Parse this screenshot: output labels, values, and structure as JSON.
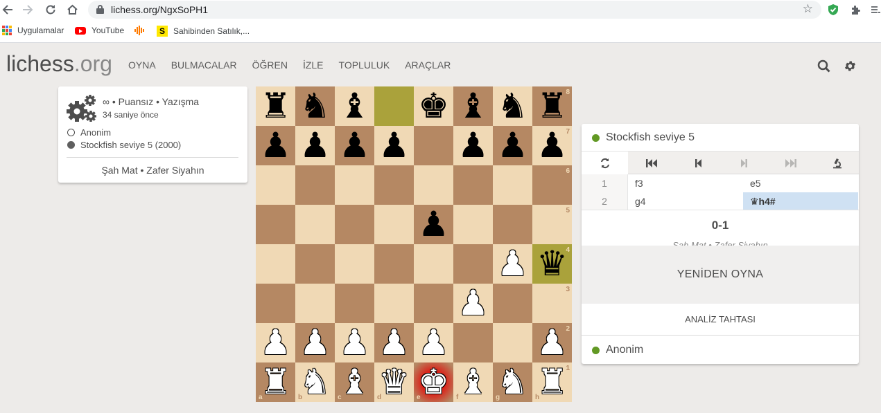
{
  "browser": {
    "url": "lichess.org/NgxSoPH1",
    "bookmarks": [
      {
        "label": "Uygulamalar",
        "icon": "apps-grid-icon"
      },
      {
        "label": "YouTube",
        "icon": "youtube-icon"
      },
      {
        "label": "",
        "icon": "soundwave-icon"
      },
      {
        "label": "Sahibinden Satılık,...",
        "icon": "sahibinden-icon"
      }
    ]
  },
  "header": {
    "logo_main": "lichess",
    "logo_tld": ".org",
    "nav": [
      "OYNA",
      "BULMACALAR",
      "ÖĞREN",
      "İZLE",
      "TOPLULUK",
      "ARAÇLAR"
    ]
  },
  "game_meta": {
    "line1": "∞ • Puansız • Yazışma",
    "line2": "34 saniye önce",
    "white_player": "Anonim",
    "black_player": "Stockfish seviye 5 (2000)",
    "status": "Şah Mat • Zafer Siyahın"
  },
  "board": {
    "ranks": [
      "8",
      "7",
      "6",
      "5",
      "4",
      "3",
      "2",
      "1"
    ],
    "files": [
      "a",
      "b",
      "c",
      "d",
      "e",
      "f",
      "g",
      "h"
    ],
    "position": [
      [
        "bR",
        "bN",
        "bB",
        "",
        "bK",
        "bB",
        "bN",
        "bR"
      ],
      [
        "bP",
        "bP",
        "bP",
        "bP",
        "",
        "bP",
        "bP",
        "bP"
      ],
      [
        "",
        "",
        "",
        "",
        "",
        "",
        "",
        ""
      ],
      [
        "",
        "",
        "",
        "",
        "bP",
        "",
        "",
        ""
      ],
      [
        "",
        "",
        "",
        "",
        "",
        "",
        "wP",
        "bQ"
      ],
      [
        "",
        "",
        "",
        "",
        "",
        "wP",
        "",
        ""
      ],
      [
        "wP",
        "wP",
        "wP",
        "wP",
        "wP",
        "",
        "",
        "wP"
      ],
      [
        "wR",
        "wN",
        "wB",
        "wQ",
        "wK",
        "wB",
        "wN",
        "wR"
      ]
    ],
    "last_move": [
      "d8",
      "h4"
    ],
    "check_square": "e1"
  },
  "panel": {
    "top_player": "Stockfish seviye 5",
    "bottom_player": "Anonim",
    "moves": [
      {
        "num": "1",
        "white": "f3",
        "black": "e5"
      },
      {
        "num": "2",
        "white": "g4",
        "black": "♛h4#"
      }
    ],
    "result": "0-1",
    "result_sub": "Şah Mat • Zafer Siyahın",
    "replay_label": "YENİDEN OYNA",
    "analysis_label": "ANALİZ TAHTASI"
  }
}
